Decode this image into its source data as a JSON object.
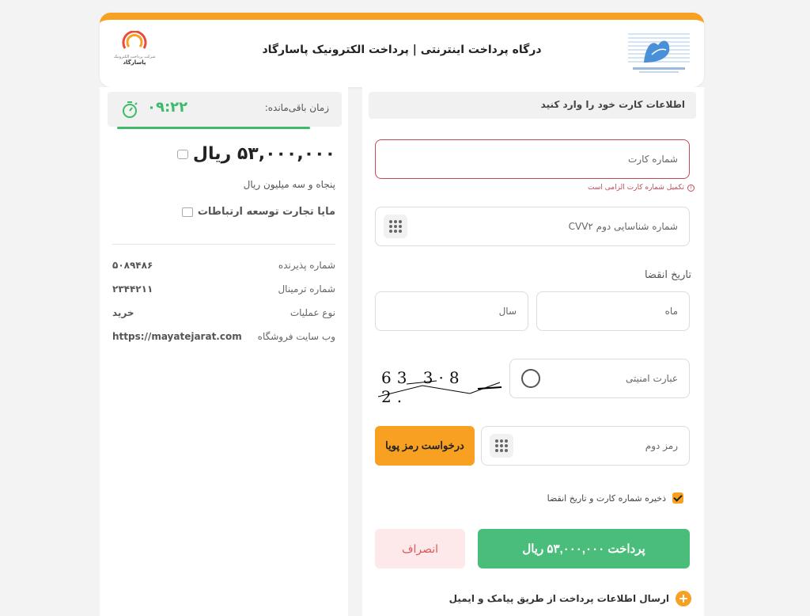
{
  "header": {
    "title": "درگاه پرداخت اینترنتی | پرداخت الکترونیک پاسارگاد",
    "psp_logo_small": "شرکت پرداخت الکترونیک",
    "psp_logo_name": "پاسارگاد"
  },
  "summary": {
    "timer_label": "زمان باقی‌مانده:",
    "timer_value": "۰۹:۲۲",
    "amount": "۵۳,۰۰۰,۰۰۰ ریال",
    "amount_words": "پنجاه و سه میلیون ریال",
    "merchant": "مایا تجارت توسعه ارتباطات",
    "rows": [
      {
        "label": "شماره پذیرنده",
        "value": "۵۰۸۹۴۸۶"
      },
      {
        "label": "شماره ترمینال",
        "value": "۲۳۴۴۲۱۱"
      },
      {
        "label": "نوع عملیات",
        "value": "خرید"
      },
      {
        "label": "وب سایت فروشگاه",
        "value": "https://mayatejarat.com"
      }
    ]
  },
  "form": {
    "heading": "اطلاعات کارت خود را وارد کنید",
    "card_placeholder": "شماره کارت",
    "card_error": "تکمیل شماره کارت الزامی است",
    "cvv2_placeholder": "شماره شناسایی دوم CVV۲",
    "expiry_title": "تاریخ انقضا",
    "month_placeholder": "ماه",
    "year_placeholder": "سال",
    "captcha_placeholder": "عبارت امنیتی",
    "captcha_text": "63 3·8 2.",
    "second_pin_placeholder": "رمز دوم",
    "otp_button": "درخواست رمز پویا",
    "save_label": "ذخیره شماره کارت و تاریخ انقضا",
    "pay_button": "پرداخت ۵۳,۰۰۰,۰۰۰ ریال",
    "cancel_button": "انصراف",
    "sms_label": "ارسال اطلاعات پرداخت از طریق پیامک و ایمیل"
  }
}
